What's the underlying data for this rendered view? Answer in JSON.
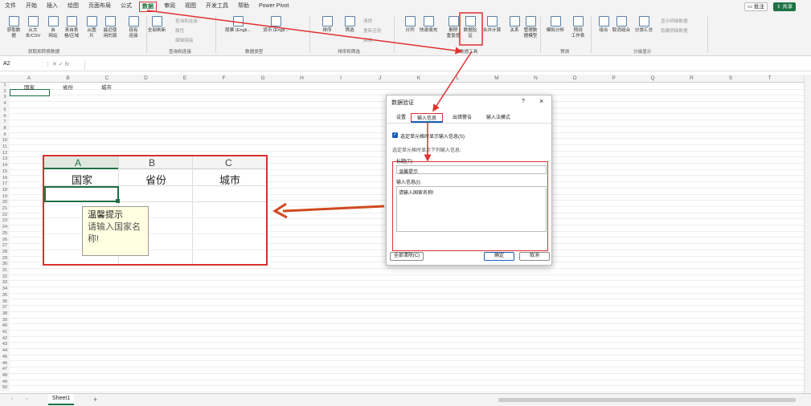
{
  "menubar": {
    "items": [
      "文件",
      "开始",
      "插入",
      "绘图",
      "页面布局",
      "公式",
      "数据",
      "审阅",
      "视图",
      "开发工具",
      "帮助",
      "Power Pivot"
    ],
    "active": "数据",
    "comment": "批注",
    "share": "共享"
  },
  "ribbon": {
    "get_data": [
      "获取数\n据",
      "从文\n本/CSV",
      "自\n网站",
      "来自表\n格/区域",
      "从图\n片",
      "最近使\n用的源",
      "现有\n连接"
    ],
    "refresh": "全部刷新",
    "queries": [
      "查询和连接",
      "属性",
      "编辑链接"
    ],
    "data_types": [
      "股票 (Engli...",
      "货币 (Engli..."
    ],
    "sort": [
      "排序",
      "筛选"
    ],
    "filter_small": [
      "清除",
      "重新应用",
      "高级"
    ],
    "tools": [
      "分列",
      "快速填充",
      "删除\n重复值",
      "数据验\n证",
      "合并计算",
      "关系",
      "管理数\n据模型"
    ],
    "forecast": [
      "模拟分析",
      "预测\n工作表"
    ],
    "outline": [
      "组合",
      "取消组合",
      "分类汇总"
    ],
    "outline_small": [
      "显示明细数据",
      "隐藏明细数据"
    ],
    "groups": [
      "获取和转换数据",
      "查询和连接",
      "数据类型",
      "排序和筛选",
      "数据工具",
      "预测",
      "分级显示"
    ]
  },
  "formula": {
    "cell_ref": "A2",
    "fx": "fx"
  },
  "sheet": {
    "columns": [
      "A",
      "B",
      "C",
      "D",
      "E",
      "F",
      "G",
      "H",
      "I",
      "J",
      "K",
      "L",
      "M",
      "N",
      "O",
      "P",
      "Q",
      "R",
      "S",
      "T"
    ],
    "row1": [
      "国家",
      "省份",
      "城市"
    ]
  },
  "zoom": {
    "columns": [
      "A",
      "B",
      "C"
    ],
    "headers": [
      "国家",
      "省份",
      "城市"
    ],
    "tooltip_title": "温馨提示",
    "tooltip_body": "请输入国家名称!"
  },
  "dialog": {
    "title": "数据验证",
    "help": "?",
    "close": "×",
    "tabs": [
      "设置",
      "输入信息",
      "出错警告",
      "输入法模式"
    ],
    "active_tab": "输入信息",
    "checkbox_label": "选定单元格时显示输入信息(S)",
    "section": "选定单元格时显示下列输入信息:",
    "title_label": "标题(T):",
    "title_value": "温馨提示",
    "message_label": "输入信息(I):",
    "message_value": "请输入国家名称!",
    "clear_all": "全部清除(C)",
    "ok": "确定",
    "cancel": "取消"
  },
  "tabs": {
    "sheet": "Sheet1",
    "add": "+"
  },
  "colors": {
    "excel_green": "#1e7145",
    "annotation_red": "#e03030",
    "arrow_orange": "#d04a1e"
  }
}
